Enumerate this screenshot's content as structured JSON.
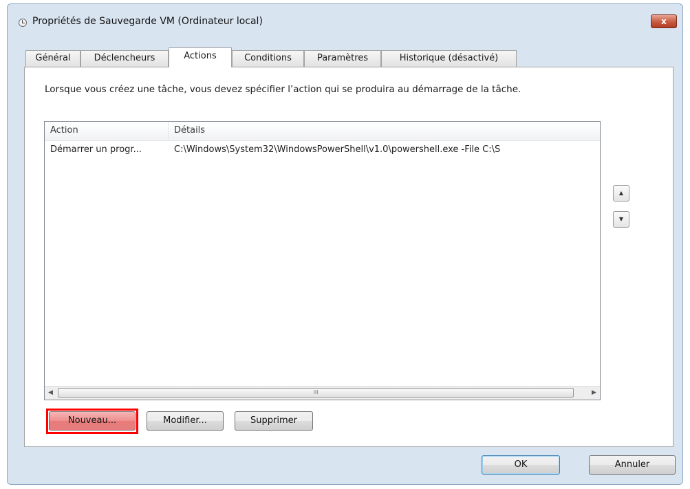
{
  "window": {
    "title": "Propriétés de Sauvegarde VM (Ordinateur local)",
    "close_label": "x"
  },
  "tabs": [
    {
      "label": "Général"
    },
    {
      "label": "Déclencheurs"
    },
    {
      "label": "Actions"
    },
    {
      "label": "Conditions"
    },
    {
      "label": "Paramètres"
    },
    {
      "label": "Historique (désactivé)"
    }
  ],
  "active_tab": "Actions",
  "content": {
    "intro": "Lorsque vous créez une tâche, vous devez spécifier l’action qui se produira au démarrage de la tâche."
  },
  "actions_list": {
    "columns": [
      "Action",
      "Détails"
    ],
    "rows": [
      {
        "action": "Démarrer un progr...",
        "details": "C:\\Windows\\System32\\WindowsPowerShell\\v1.0\\powershell.exe -File C:\\S"
      }
    ],
    "scroll_thumb_grip": "III"
  },
  "buttons": {
    "move_up": "▲",
    "move_down": "▼",
    "new": "Nouveau...",
    "edit": "Modifier...",
    "delete": "Supprimer",
    "ok": "OK",
    "cancel": "Annuler"
  },
  "colors": {
    "highlight": "#ff0000",
    "window_frame": "#d9e4f1"
  }
}
